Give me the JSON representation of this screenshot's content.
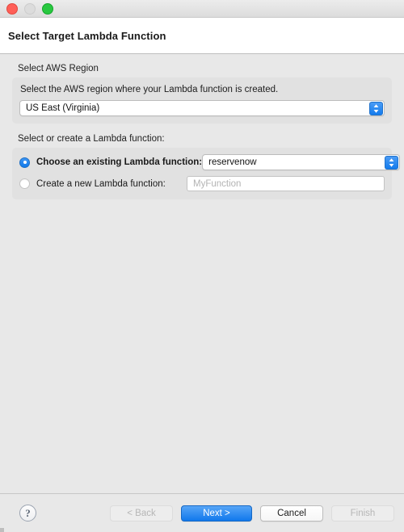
{
  "window": {
    "traffic_lights": [
      {
        "name": "close",
        "color": "#ff5f57",
        "enabled": true
      },
      {
        "name": "minimize",
        "color": "#dcdcdc",
        "enabled": false
      },
      {
        "name": "zoom",
        "color": "#28c840",
        "enabled": true
      }
    ]
  },
  "header": {
    "title": "Select Target Lambda Function"
  },
  "region_section": {
    "group_label": "Select AWS Region",
    "description": "Select the AWS region where your Lambda function is created.",
    "region_combo": {
      "value": "US East (Virginia)",
      "icon": "chevron-up-down-icon"
    }
  },
  "function_section": {
    "group_label": "Select or create a Lambda function:",
    "existing": {
      "label": "Choose an existing Lambda function:",
      "selected": true,
      "combo": {
        "value": "reservenow",
        "icon": "chevron-up-down-icon"
      }
    },
    "create_new": {
      "label": "Create a new Lambda function:",
      "selected": false,
      "input": {
        "value": "",
        "placeholder": "MyFunction"
      }
    }
  },
  "footer": {
    "help_label": "?",
    "buttons": [
      {
        "label": "< Back",
        "state": "disabled"
      },
      {
        "label": "Next >",
        "state": "default"
      },
      {
        "label": "Cancel",
        "state": "enabled"
      },
      {
        "label": "Finish",
        "state": "disabled"
      }
    ]
  },
  "colors": {
    "accent_blue": "#1078ec",
    "window_bg": "#e8e8e8",
    "panel_bg": "#e1e1e1",
    "header_bg": "#ffffff"
  }
}
